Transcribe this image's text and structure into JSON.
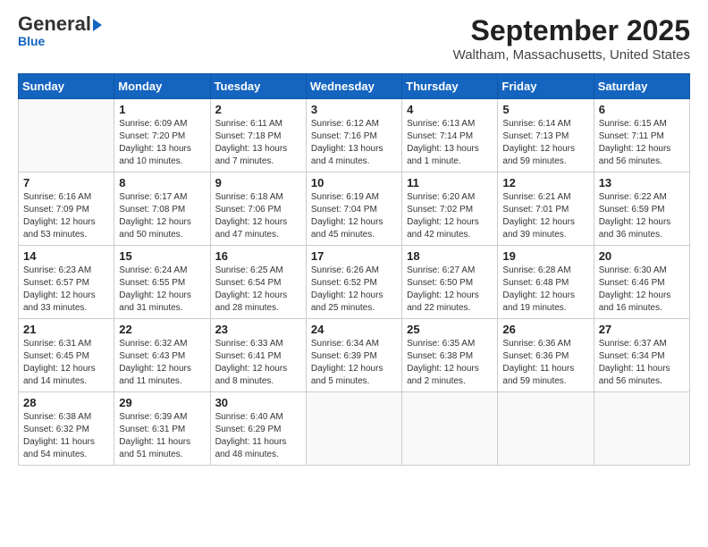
{
  "logo": {
    "line1": "General",
    "line2": "Blue",
    "arrow": true
  },
  "header": {
    "month": "September 2025",
    "location": "Waltham, Massachusetts, United States"
  },
  "weekdays": [
    "Sunday",
    "Monday",
    "Tuesday",
    "Wednesday",
    "Thursday",
    "Friday",
    "Saturday"
  ],
  "weeks": [
    [
      {
        "day": "",
        "info": ""
      },
      {
        "day": "1",
        "info": "Sunrise: 6:09 AM\nSunset: 7:20 PM\nDaylight: 13 hours\nand 10 minutes."
      },
      {
        "day": "2",
        "info": "Sunrise: 6:11 AM\nSunset: 7:18 PM\nDaylight: 13 hours\nand 7 minutes."
      },
      {
        "day": "3",
        "info": "Sunrise: 6:12 AM\nSunset: 7:16 PM\nDaylight: 13 hours\nand 4 minutes."
      },
      {
        "day": "4",
        "info": "Sunrise: 6:13 AM\nSunset: 7:14 PM\nDaylight: 13 hours\nand 1 minute."
      },
      {
        "day": "5",
        "info": "Sunrise: 6:14 AM\nSunset: 7:13 PM\nDaylight: 12 hours\nand 59 minutes."
      },
      {
        "day": "6",
        "info": "Sunrise: 6:15 AM\nSunset: 7:11 PM\nDaylight: 12 hours\nand 56 minutes."
      }
    ],
    [
      {
        "day": "7",
        "info": "Sunrise: 6:16 AM\nSunset: 7:09 PM\nDaylight: 12 hours\nand 53 minutes."
      },
      {
        "day": "8",
        "info": "Sunrise: 6:17 AM\nSunset: 7:08 PM\nDaylight: 12 hours\nand 50 minutes."
      },
      {
        "day": "9",
        "info": "Sunrise: 6:18 AM\nSunset: 7:06 PM\nDaylight: 12 hours\nand 47 minutes."
      },
      {
        "day": "10",
        "info": "Sunrise: 6:19 AM\nSunset: 7:04 PM\nDaylight: 12 hours\nand 45 minutes."
      },
      {
        "day": "11",
        "info": "Sunrise: 6:20 AM\nSunset: 7:02 PM\nDaylight: 12 hours\nand 42 minutes."
      },
      {
        "day": "12",
        "info": "Sunrise: 6:21 AM\nSunset: 7:01 PM\nDaylight: 12 hours\nand 39 minutes."
      },
      {
        "day": "13",
        "info": "Sunrise: 6:22 AM\nSunset: 6:59 PM\nDaylight: 12 hours\nand 36 minutes."
      }
    ],
    [
      {
        "day": "14",
        "info": "Sunrise: 6:23 AM\nSunset: 6:57 PM\nDaylight: 12 hours\nand 33 minutes."
      },
      {
        "day": "15",
        "info": "Sunrise: 6:24 AM\nSunset: 6:55 PM\nDaylight: 12 hours\nand 31 minutes."
      },
      {
        "day": "16",
        "info": "Sunrise: 6:25 AM\nSunset: 6:54 PM\nDaylight: 12 hours\nand 28 minutes."
      },
      {
        "day": "17",
        "info": "Sunrise: 6:26 AM\nSunset: 6:52 PM\nDaylight: 12 hours\nand 25 minutes."
      },
      {
        "day": "18",
        "info": "Sunrise: 6:27 AM\nSunset: 6:50 PM\nDaylight: 12 hours\nand 22 minutes."
      },
      {
        "day": "19",
        "info": "Sunrise: 6:28 AM\nSunset: 6:48 PM\nDaylight: 12 hours\nand 19 minutes."
      },
      {
        "day": "20",
        "info": "Sunrise: 6:30 AM\nSunset: 6:46 PM\nDaylight: 12 hours\nand 16 minutes."
      }
    ],
    [
      {
        "day": "21",
        "info": "Sunrise: 6:31 AM\nSunset: 6:45 PM\nDaylight: 12 hours\nand 14 minutes."
      },
      {
        "day": "22",
        "info": "Sunrise: 6:32 AM\nSunset: 6:43 PM\nDaylight: 12 hours\nand 11 minutes."
      },
      {
        "day": "23",
        "info": "Sunrise: 6:33 AM\nSunset: 6:41 PM\nDaylight: 12 hours\nand 8 minutes."
      },
      {
        "day": "24",
        "info": "Sunrise: 6:34 AM\nSunset: 6:39 PM\nDaylight: 12 hours\nand 5 minutes."
      },
      {
        "day": "25",
        "info": "Sunrise: 6:35 AM\nSunset: 6:38 PM\nDaylight: 12 hours\nand 2 minutes."
      },
      {
        "day": "26",
        "info": "Sunrise: 6:36 AM\nSunset: 6:36 PM\nDaylight: 11 hours\nand 59 minutes."
      },
      {
        "day": "27",
        "info": "Sunrise: 6:37 AM\nSunset: 6:34 PM\nDaylight: 11 hours\nand 56 minutes."
      }
    ],
    [
      {
        "day": "28",
        "info": "Sunrise: 6:38 AM\nSunset: 6:32 PM\nDaylight: 11 hours\nand 54 minutes."
      },
      {
        "day": "29",
        "info": "Sunrise: 6:39 AM\nSunset: 6:31 PM\nDaylight: 11 hours\nand 51 minutes."
      },
      {
        "day": "30",
        "info": "Sunrise: 6:40 AM\nSunset: 6:29 PM\nDaylight: 11 hours\nand 48 minutes."
      },
      {
        "day": "",
        "info": ""
      },
      {
        "day": "",
        "info": ""
      },
      {
        "day": "",
        "info": ""
      },
      {
        "day": "",
        "info": ""
      }
    ]
  ]
}
